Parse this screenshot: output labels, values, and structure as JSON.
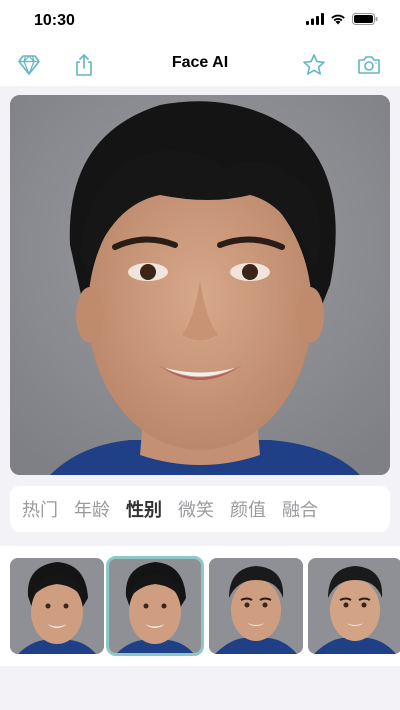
{
  "status": {
    "time": "10:30"
  },
  "nav": {
    "title": "Face AI",
    "accent_color": "#62b7c0"
  },
  "photo": {
    "description_icon": "portrait-photo"
  },
  "tabs": {
    "items": [
      "热门",
      "年龄",
      "性别",
      "微笑",
      "颜值",
      "融合"
    ],
    "active_index": 2
  },
  "thumbnails": {
    "selected_index": 1,
    "items": [
      "female-portrait",
      "female-portrait-selected",
      "male-portrait",
      "male-portrait"
    ]
  }
}
